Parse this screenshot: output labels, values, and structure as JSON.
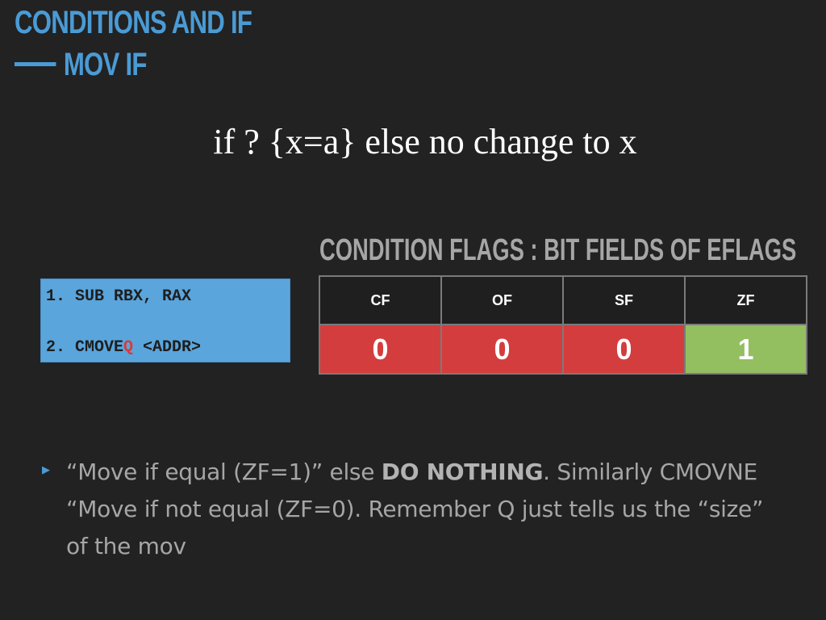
{
  "slide": {
    "title_line1": "CONDITIONS AND IF",
    "title_line2": "MOV IF",
    "headline": "if ? {x=a} else no change to x"
  },
  "code": {
    "line1": "1. SUB RBX, RAX",
    "line2_prefix": "2. CMOVE",
    "line2_suffix": "Q",
    "line2_operand": " <ADDR>",
    "suffix_color": "#d93a3a"
  },
  "flags": {
    "heading": "CONDITION FLAGS :  BIT FIELDS OF EFLAGS",
    "columns": [
      {
        "name": "CF",
        "value": "0",
        "color": "#d43d3d"
      },
      {
        "name": "OF",
        "value": "0",
        "color": "#d43d3d"
      },
      {
        "name": "SF",
        "value": "0",
        "color": "#d43d3d"
      },
      {
        "name": "ZF",
        "value": "1",
        "color": "#93bf60"
      }
    ]
  },
  "bullet": {
    "part1": "“Move if equal (ZF=1)” else ",
    "emphasis": "DO NOTHING",
    "part2": ".  Similarly CMOVNE “Move if not equal (ZF=0).  Remember Q just tells us the “size” of the mov"
  },
  "colors": {
    "background": "#222222",
    "title": "#4a9bd5",
    "code_box": "#5aa5dc",
    "flag_false": "#d43d3d",
    "flag_true": "#93bf60"
  }
}
